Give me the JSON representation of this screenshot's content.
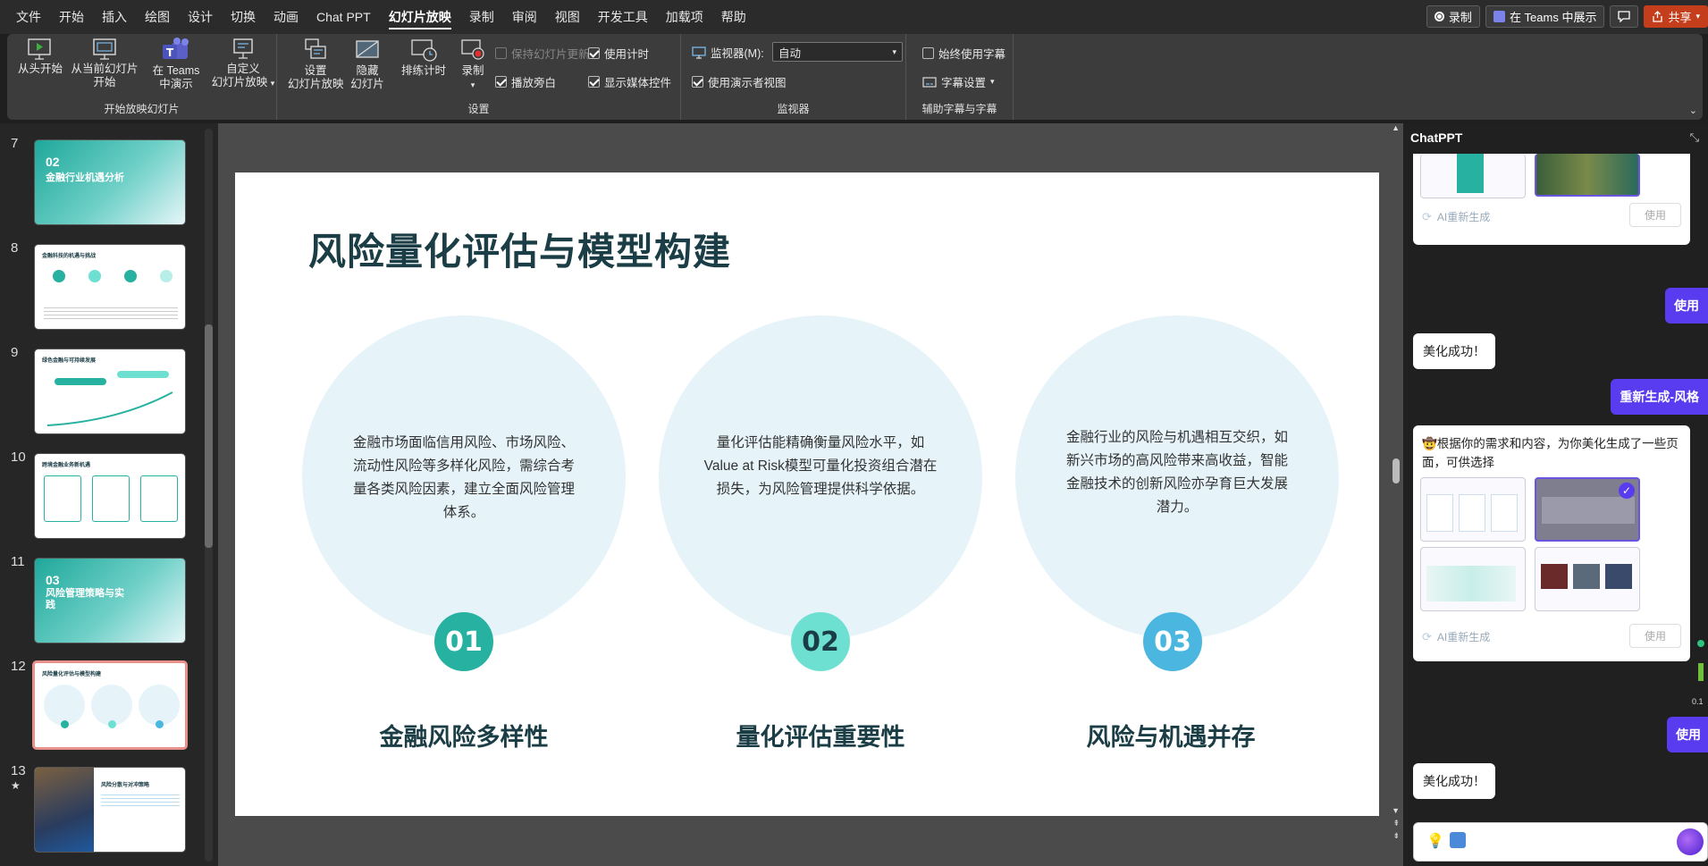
{
  "menu": {
    "items": [
      "文件",
      "开始",
      "插入",
      "绘图",
      "设计",
      "切换",
      "动画",
      "Chat PPT",
      "幻灯片放映",
      "录制",
      "审阅",
      "视图",
      "开发工具",
      "加载项",
      "帮助"
    ],
    "active_index": 8,
    "record_label": "录制",
    "teams_label": "在 Teams 中展示",
    "share_label": "共享"
  },
  "ribbon": {
    "from_start": "从头开始",
    "from_current_1": "从当前幻灯片",
    "from_current_2": "开始",
    "teams_1": "在 Teams",
    "teams_2": "中演示",
    "custom_1": "自定义",
    "custom_2": "幻灯片放映",
    "group_start": "开始放映幻灯片",
    "setup_1": "设置",
    "setup_2": "幻灯片放映",
    "hide_1": "隐藏",
    "hide_2": "幻灯片",
    "rehearse": "排练计时",
    "record": "录制",
    "keep_updated": "保持幻灯片更新",
    "play_narration": "播放旁白",
    "use_timings": "使用计时",
    "show_media": "显示媒体控件",
    "group_setup": "设置",
    "monitor_label": "监视器(M):",
    "monitor_value": "自动",
    "presenter_view": "使用演示者视图",
    "group_monitor": "监视器",
    "always_subtitles": "始终使用字幕",
    "subtitle_settings": "字幕设置",
    "group_captions": "辅助字幕与字幕"
  },
  "thumbnails": [
    {
      "num": "7",
      "title": "02",
      "subtitle": "金融行业机遇分析"
    },
    {
      "num": "8",
      "title": "金融科技的机遇与挑战"
    },
    {
      "num": "9",
      "title": "绿色金融与可持续发展"
    },
    {
      "num": "10",
      "title": "跨境金融业务新机遇"
    },
    {
      "num": "11",
      "title": "03",
      "subtitle": "风险管理策略与实践"
    },
    {
      "num": "12",
      "title": "风险量化评估与模型构建"
    },
    {
      "num": "13",
      "star": "★",
      "title": "风险分散与对冲策略"
    }
  ],
  "slide": {
    "title": "风险量化评估与模型构建",
    "columns": [
      {
        "text": "金融市场面临信用风险、市场风险、流动性风险等多样化风险，需综合考量各类风险因素，建立全面风险管理体系。",
        "num": "01",
        "heading": "金融风险多样性",
        "color": "#26b1a0"
      },
      {
        "text": "量化评估能精确衡量风险水平，如Value at Risk模型可量化投资组合潜在损失，为风险管理提供科学依据。",
        "num": "02",
        "heading": "量化评估重要性",
        "color": "#6ee0d2"
      },
      {
        "text": "金融行业的风险与机遇相互交织，如新兴市场的高风险带来高收益，智能金融技术的创新风险亦孕育巨大发展潜力。",
        "num": "03",
        "heading": "风险与机遇并存",
        "color": "#4bb7e0"
      }
    ]
  },
  "chat": {
    "title": "ChatPPT",
    "regen": "AI重新生成",
    "use": "使用",
    "use_btn_right": "使用",
    "success": "美化成功！",
    "regen_style": "重新生成-风格",
    "prompt_msg": "🤠根据你的需求和内容，为你美化生成了一些页面，可供选择",
    "use_partial": "使用",
    "side_value": "0.1"
  }
}
